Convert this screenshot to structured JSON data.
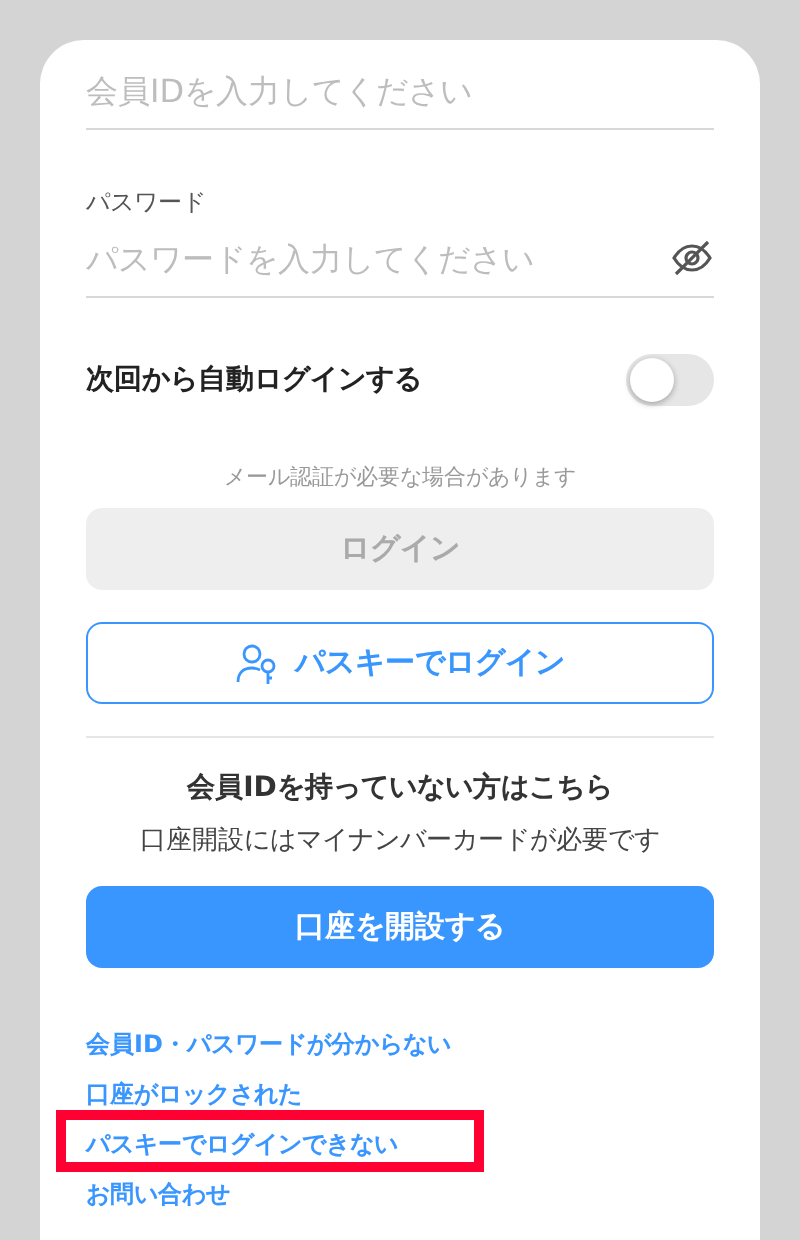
{
  "member_id_field": {
    "placeholder": "会員IDを入力してください"
  },
  "password_field": {
    "label": "パスワード",
    "placeholder": "パスワードを入力してください",
    "visible": false
  },
  "auto_login": {
    "label": "次回から自動ログインする",
    "on": false
  },
  "notice": "メール認証が必要な場合があります",
  "login_button": {
    "label": "ログイン",
    "disabled": true
  },
  "passkey_button": {
    "label": "パスキーでログイン"
  },
  "signup": {
    "heading": "会員IDを持っていない方はこちら",
    "note": "口座開設にはマイナンバーカードが必要です",
    "button": "口座を開設する"
  },
  "help_links": [
    {
      "label": "会員ID・パスワードが分からない",
      "highlighted": false
    },
    {
      "label": "口座がロックされた",
      "highlighted": false
    },
    {
      "label": "パスキーでログインできない",
      "highlighted": true
    },
    {
      "label": "お問い合わせ",
      "highlighted": false
    }
  ]
}
